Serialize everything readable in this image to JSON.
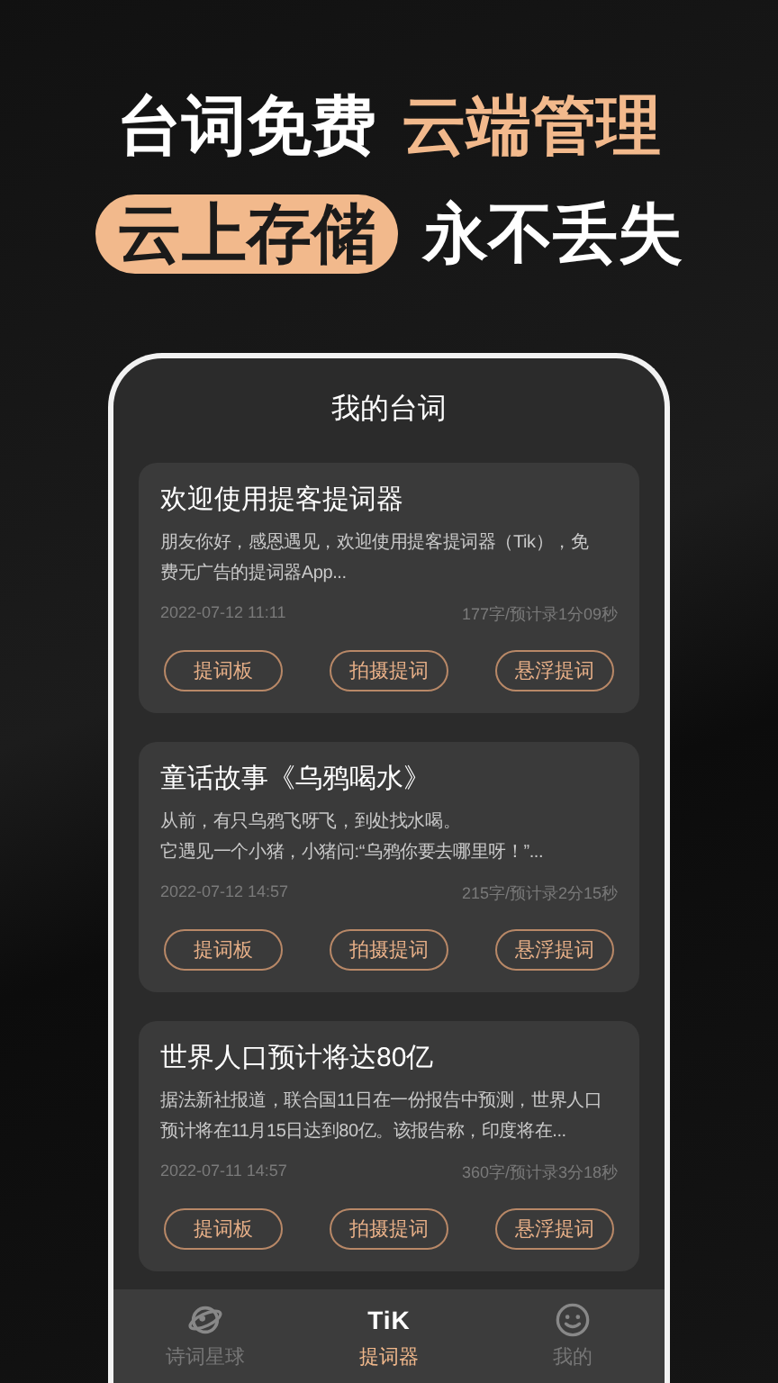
{
  "headline": {
    "line_1": [
      {
        "text": "台词免费",
        "accent": false
      },
      {
        "text": "云端管理",
        "accent": true
      }
    ],
    "line_2": [
      {
        "text": "云上存储",
        "accent": true
      },
      {
        "text": "永不丢失",
        "accent": false
      }
    ]
  },
  "screen": {
    "title": "我的台词",
    "scripts": [
      {
        "title": "欢迎使用提客提词器",
        "excerpt": [
          "朋友你好，感恩遇见，欢迎使用提客提词器（Tik），免",
          "费无广告的提词器App..."
        ],
        "date": "2022-07-12 11:11",
        "stats": "177字/预计录1分09秒",
        "actions": [
          "提词板",
          "拍摄提词",
          "悬浮提词"
        ]
      },
      {
        "title": "童话故事《乌鸦喝水》",
        "excerpt": [
          "从前，有只乌鸦飞呀飞，到处找水喝。",
          "它遇见一个小猪，小猪问:“乌鸦你要去哪里呀！”..."
        ],
        "date": "2022-07-12 14:57",
        "stats": "215字/预计录2分15秒",
        "actions": [
          "提词板",
          "拍摄提词",
          "悬浮提词"
        ]
      },
      {
        "title": "世界人口预计将达80亿",
        "excerpt": [
          "据法新社报道，联合国11日在一份报告中预测，世界人口",
          "预计将在11月15日达到80亿。该报告称，印度将在..."
        ],
        "date": "2022-07-11 14:57",
        "stats": "360字/预计录3分18秒",
        "actions": [
          "提词板",
          "拍摄提词",
          "悬浮提词"
        ]
      }
    ],
    "tabs": [
      {
        "kind": "planet",
        "label": "诗词星球",
        "selected": false
      },
      {
        "kind": "logo",
        "logo": "TiK",
        "label": "提词器",
        "selected": true
      },
      {
        "kind": "smile",
        "label": "我的",
        "selected": false
      }
    ]
  }
}
